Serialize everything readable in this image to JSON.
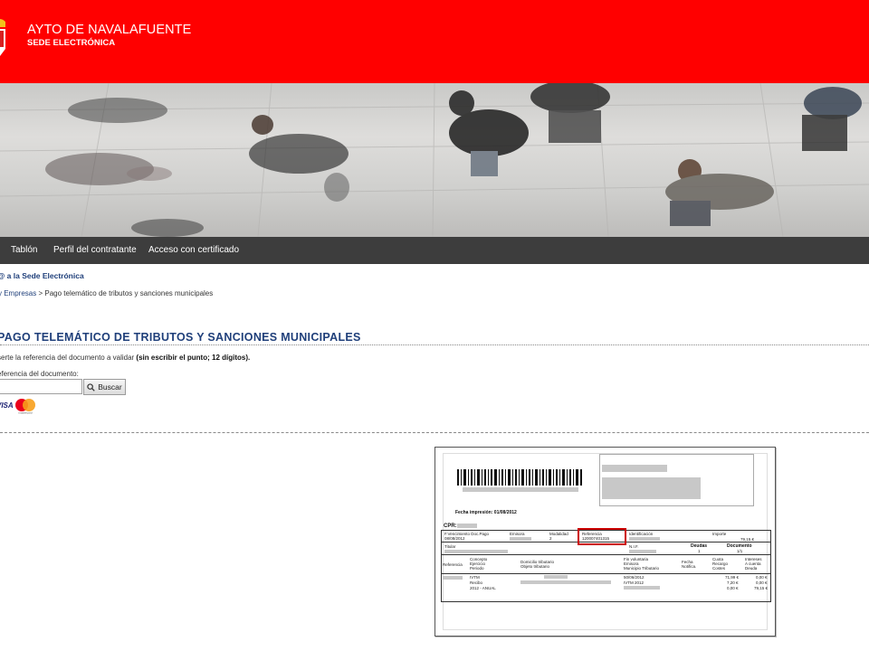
{
  "header": {
    "org_name": "AYTO DE NAVALAFUENTE",
    "org_sub": "SEDE ELECTRÓNICA",
    "background_color": "#ff0000"
  },
  "nav": {
    "items": [
      {
        "label": "Tablón"
      },
      {
        "label": "Perfil del contratante"
      },
      {
        "label": "Acceso con certificado"
      }
    ]
  },
  "welcome_text": "@ a la Sede Electrónica",
  "breadcrumb": {
    "link": "y Empresas",
    "separator": " > ",
    "current": "Pago telemático de tributos y sanciones municipales"
  },
  "page_title": "PAGO TELEMÁTICO DE TRIBUTOS Y SANCIONES MUNICIPALES",
  "instruction": {
    "text": "serte la referencia del documento a validar ",
    "bold": "(sin escribir el punto; 12 dígitos)."
  },
  "form": {
    "field_label": "eferencia del documento:",
    "input_value": "",
    "search_label": "Buscar",
    "search_icon": "magnifier-icon"
  },
  "payment_cards": [
    "VISA",
    "mastercard"
  ],
  "document_example": {
    "fecha_impresion": "Fecha impresión: 01/08/2012",
    "cpr": "CPR:",
    "vencimiento_label": "F.Vencimiento Doc.Pago",
    "vencimiento_value": "08/08/2012",
    "emisora_label": "Emisora",
    "modalidad_label": "Modalidad",
    "modalidad_value": "2",
    "referencia_label": "Referencia",
    "referencia_value": "120007401315",
    "identificacion_label": "Identificación",
    "importe_label": "Importe",
    "importe_value": "79,15 €",
    "titular_label": "Titular",
    "nif_label": "N.I.F.",
    "deudas_label": "Deudas",
    "deudas_value": "1",
    "documento_label": "Documento",
    "documento_value": "1/1",
    "col_referencia": "Referencia",
    "col_concepto": "Concepto\nEjercicio\nPeriodo",
    "col_domicilio": "Domicilio tributario\nObjeto tributario",
    "col_fin": "Fin voluntaria\nEmisora\nMunicipio Tributario",
    "col_fecha": "Fecha\nNotifica.",
    "col_cuota": "Cuota\nRecargo\nCostes",
    "col_intereses": "Intereses\nA cuenta\nDeuda",
    "row_vals": [
      "IVTM",
      "Recibo",
      "2012 - ANUAL",
      "50/06/2012",
      "IVTM 2012",
      "0,00 €",
      "71,99 €",
      "7,20 €",
      "0,00 €",
      "0,00 €",
      "79,15 €"
    ]
  }
}
